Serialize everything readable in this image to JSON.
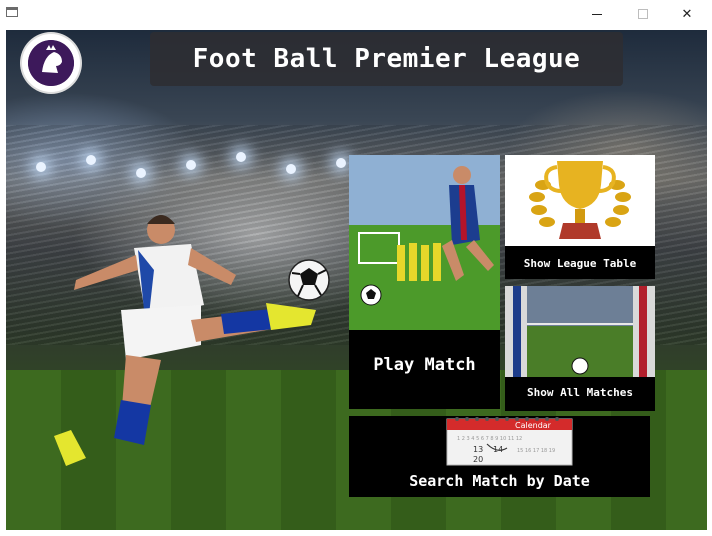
{
  "window": {
    "minimize_icon": "minimize-icon",
    "maximize_icon": "maximize-icon",
    "close_icon": "close-icon",
    "close_glyph": "✕"
  },
  "header": {
    "title": "Foot Ball Premier League",
    "logo_icon": "premier-league-lion-icon"
  },
  "menu": {
    "play_match": "Play Match",
    "show_league_table": "Show League Table",
    "show_all_matches": "Show All Matches",
    "search_match_by_date": "Search Match by Date",
    "calendar_word": "Calendar"
  },
  "colors": {
    "tile_background": "#000000",
    "title_banner": "#2d2d32",
    "trophy_gold": "#e7b321"
  }
}
